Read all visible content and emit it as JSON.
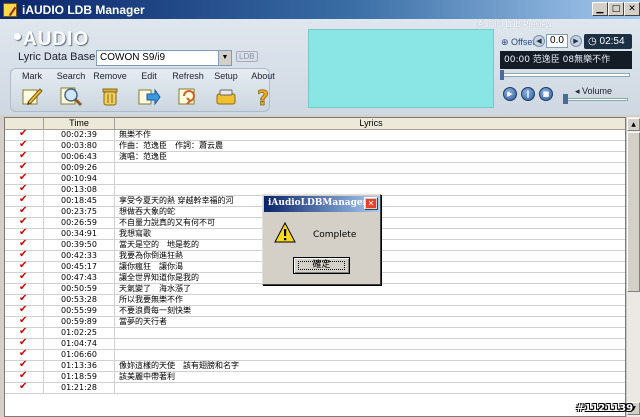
{
  "window": {
    "title": "iAUDIO LDB Manager"
  },
  "header": {
    "logo_text": "AUDIO",
    "lyric_db_label": "Lyric Data Base",
    "device_value": "COWON S9/i9",
    "ldb_badge": "LDB"
  },
  "toolbar": [
    {
      "label": "Mark",
      "icon": "mark-pencil-icon"
    },
    {
      "label": "Search",
      "icon": "magnifier-icon"
    },
    {
      "label": "Remove",
      "icon": "trash-icon"
    },
    {
      "label": "Edit",
      "icon": "edit-arrow-icon"
    },
    {
      "label": "Refresh",
      "icon": "refresh-icon"
    },
    {
      "label": "Setup",
      "icon": "setup-icon"
    },
    {
      "label": "About",
      "icon": "question-icon"
    }
  ],
  "preview": {
    "title": "iAUDIO LDB Preview",
    "offset_label": "Offset",
    "offset_value": "0.0",
    "clock": "02:54",
    "lcd_text": "00:00 范逸臣 08無樂不作",
    "volume_label": "Volume"
  },
  "table": {
    "columns": [
      "",
      "Time",
      "Lyrics"
    ],
    "rows": [
      {
        "time": "00:02:39",
        "lyric": "無樂不作"
      },
      {
        "time": "00:03:80",
        "lyric": "作曲：范逸臣　作詞：蕭云農"
      },
      {
        "time": "00:06:43",
        "lyric": "演唱：范逸臣"
      },
      {
        "time": "00:09:26",
        "lyric": ""
      },
      {
        "time": "00:10:94",
        "lyric": ""
      },
      {
        "time": "00:13:08",
        "lyric": ""
      },
      {
        "time": "00:18:45",
        "lyric": "享受今夏天的熱 穿越幹幸福的河"
      },
      {
        "time": "00:23:75",
        "lyric": "想做吞大象的蛇"
      },
      {
        "time": "00:26:59",
        "lyric": "不自量力說真的又有何不可"
      },
      {
        "time": "00:34:91",
        "lyric": "我想寫歌"
      },
      {
        "time": "00:39:50",
        "lyric": "當天是空的　地是乾的"
      },
      {
        "time": "00:42:33",
        "lyric": "我要為你倒進狂熱"
      },
      {
        "time": "00:45:17",
        "lyric": "讓你瘋狂　讓你渴"
      },
      {
        "time": "00:47:43",
        "lyric": "讓全世界知道你是我的"
      },
      {
        "time": "00:50:59",
        "lyric": "天氣變了　海水漲了"
      },
      {
        "time": "00:53:28",
        "lyric": "所以我要無樂不作"
      },
      {
        "time": "00:55:99",
        "lyric": "不要浪費每一刻快樂"
      },
      {
        "time": "00:59:89",
        "lyric": "當夢的天行者"
      },
      {
        "time": "01:02:25",
        "lyric": ""
      },
      {
        "time": "01:04:74",
        "lyric": ""
      },
      {
        "time": "01:06:60",
        "lyric": ""
      },
      {
        "time": "01:13:36",
        "lyric": "像妳這樣的天使　該有翅膀和名字"
      },
      {
        "time": "01:18:59",
        "lyric": "該美麗中帶著利"
      },
      {
        "time": "01:21:28",
        "lyric": ""
      }
    ]
  },
  "dialog": {
    "title": "iAudioLDBManager",
    "message": "Complete",
    "ok_label": "確定"
  },
  "watermark": "#1121139"
}
